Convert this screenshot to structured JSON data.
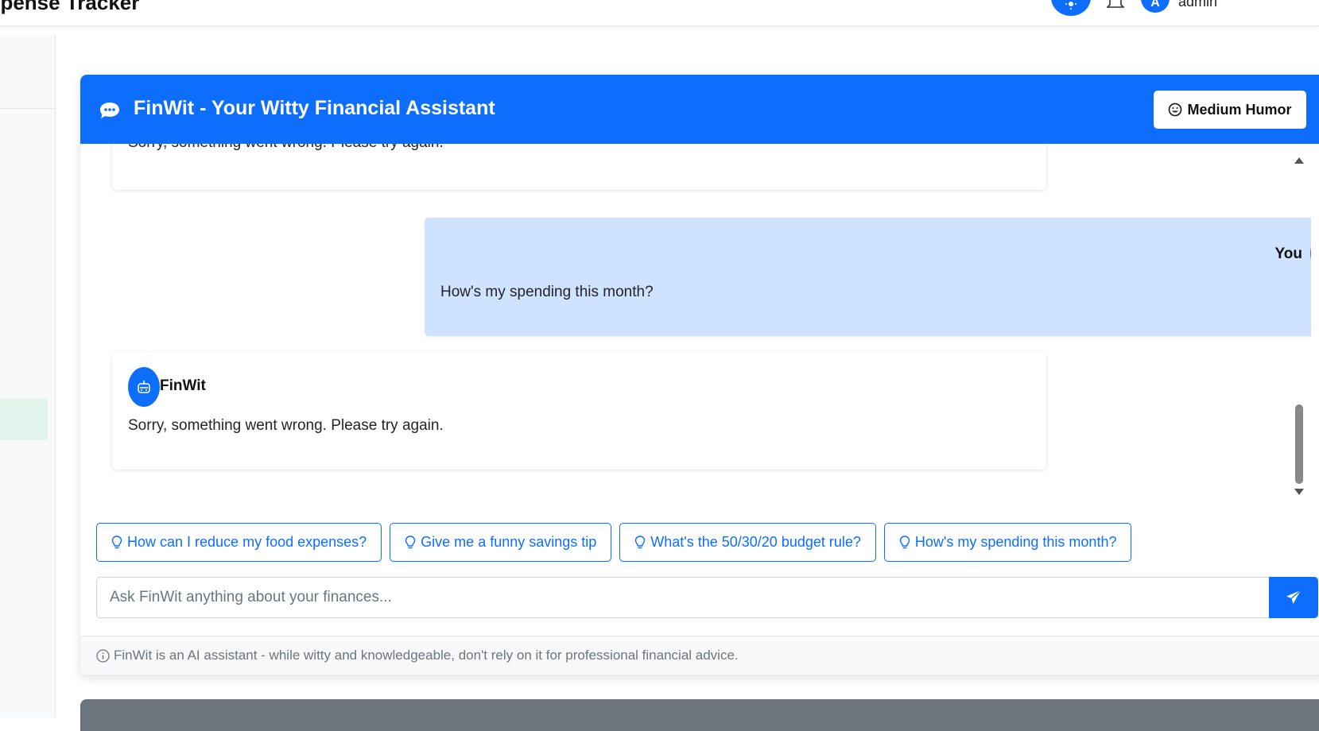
{
  "topbar": {
    "brand": "xpense Tracker",
    "user_initial": "A",
    "username": "admin"
  },
  "chat": {
    "title": "FinWit - Your Witty Financial Assistant",
    "humor_label": "Medium Humor",
    "messages": [
      {
        "sender": "bot",
        "text": "Sorry, something went wrong. Please try again."
      },
      {
        "sender": "user",
        "name": "You",
        "text": "How's my spending this month?"
      },
      {
        "sender": "bot",
        "name": "FinWit",
        "text": "Sorry, something went wrong. Please try again."
      }
    ],
    "suggestions": [
      "How can I reduce my food expenses?",
      "Give me a funny savings tip",
      "What's the 50/30/20 budget rule?",
      "How's my spending this month?"
    ],
    "input_placeholder": "Ask FinWit anything about your finances...",
    "footer": "FinWit is an AI assistant - while witty and knowledgeable, don't rely on it for professional financial advice."
  },
  "colors": {
    "primary": "#0d6efd",
    "user_bubble": "#cfe2ff",
    "user_avatar": "#6c757d"
  }
}
